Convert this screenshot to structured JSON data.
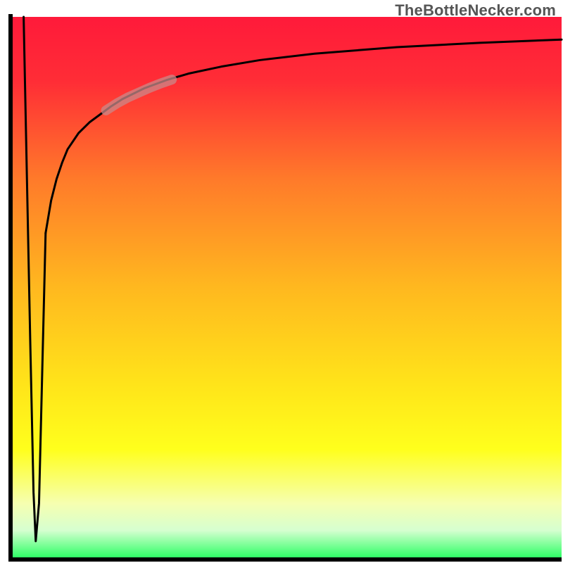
{
  "watermark": "TheBottleNecker.com",
  "chart_data": {
    "type": "line",
    "title": "",
    "xlabel": "",
    "ylabel": "",
    "xlim": [
      0,
      100
    ],
    "ylim": [
      0,
      100
    ],
    "grid": false,
    "legend": false,
    "background_gradient_stops": [
      {
        "offset": 0.0,
        "color": "#ff1a3a"
      },
      {
        "offset": 0.12,
        "color": "#ff2d36"
      },
      {
        "offset": 0.3,
        "color": "#ff7a2a"
      },
      {
        "offset": 0.5,
        "color": "#ffb81f"
      },
      {
        "offset": 0.68,
        "color": "#ffe41a"
      },
      {
        "offset": 0.8,
        "color": "#ffff1c"
      },
      {
        "offset": 0.9,
        "color": "#f6ffb0"
      },
      {
        "offset": 0.95,
        "color": "#d6ffd0"
      },
      {
        "offset": 1.0,
        "color": "#2fff66"
      }
    ],
    "axes": {
      "x_thickness": 6,
      "y_thickness": 6,
      "color": "#000000"
    },
    "series": [
      {
        "name": "down-spike",
        "color": "#000000",
        "width": 3,
        "x": [
          2.0,
          2.6,
          3.2,
          3.8,
          4.2,
          4.8,
          5.4,
          6.0
        ],
        "y": [
          100,
          70,
          40,
          12,
          3,
          10,
          35,
          60
        ]
      },
      {
        "name": "recovery-curve",
        "color": "#000000",
        "width": 3,
        "x": [
          6.0,
          7,
          8,
          9,
          10,
          12,
          14,
          16,
          18,
          20,
          24,
          28,
          32,
          38,
          45,
          55,
          70,
          85,
          100
        ],
        "y": [
          60,
          66,
          70,
          73,
          75.5,
          78.5,
          80.5,
          82,
          83.5,
          84.8,
          86.8,
          88.3,
          89.5,
          90.8,
          92.0,
          93.2,
          94.4,
          95.2,
          95.8
        ]
      }
    ],
    "highlight": {
      "name": "highlight-segment",
      "color": "#c98a8a",
      "opacity": 0.75,
      "width": 14,
      "x": [
        17,
        19,
        21,
        23,
        25,
        27,
        29
      ],
      "y": [
        82.7,
        84.0,
        85.1,
        86.0,
        86.9,
        87.7,
        88.4
      ]
    }
  }
}
